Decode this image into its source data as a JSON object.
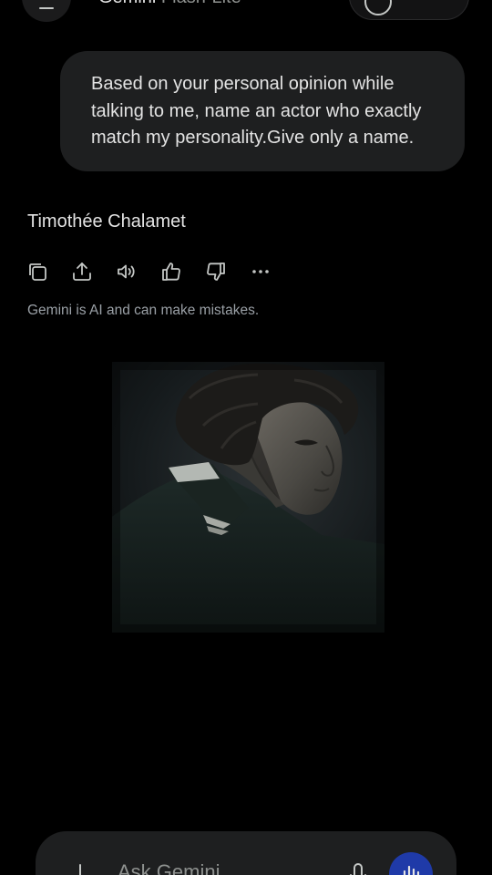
{
  "header": {
    "app_name": "Gemini",
    "model_name": "Flash-Lite"
  },
  "conversation": {
    "user_message": "Based on your personal opinion while talking to me, name an actor who exactly match my personality.Give only a name.",
    "response_text": "Timothée Chalamet",
    "actions": [
      {
        "icon": "copy-icon"
      },
      {
        "icon": "share-icon"
      },
      {
        "icon": "read-aloud-icon"
      },
      {
        "icon": "thumbs-up-icon"
      },
      {
        "icon": "thumbs-down-icon"
      },
      {
        "icon": "more-options-icon"
      }
    ],
    "disclaimer": "Gemini is AI and can make mistakes."
  },
  "input": {
    "placeholder": "Ask Gemini"
  },
  "colors": {
    "background": "#000000",
    "bubble": "#1e1f20",
    "text": "#e3e3e3",
    "muted": "#9aa0a6",
    "accent": "#1f3aa8"
  }
}
